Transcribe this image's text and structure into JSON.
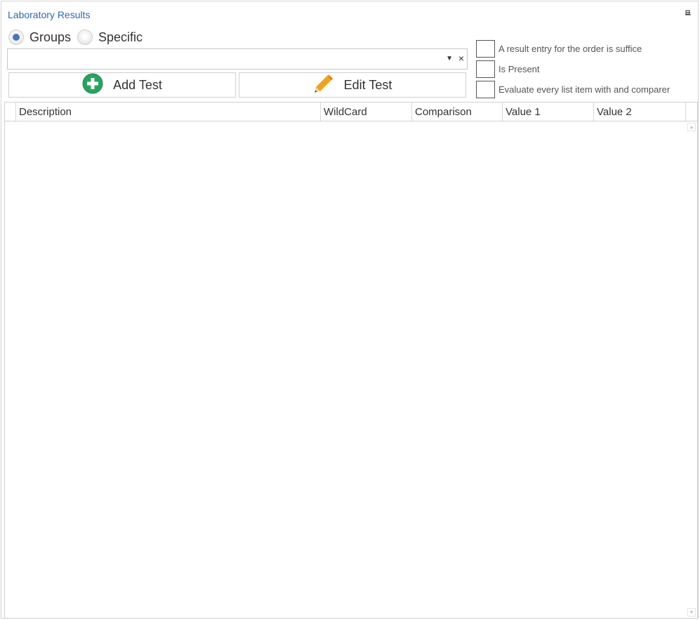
{
  "panel": {
    "title": "Laboratory Results",
    "pin_icon": "pin-icon"
  },
  "mode": {
    "options": [
      {
        "label": "Groups",
        "selected": true
      },
      {
        "label": "Specific",
        "selected": false
      }
    ]
  },
  "selector": {
    "value": "",
    "dropdown_icon": "chevron-down-icon",
    "clear_icon": "close-icon",
    "clear_glyph": "×",
    "arrow_glyph": "▼"
  },
  "buttons": {
    "add_label": "Add Test",
    "add_icon": "plus-circle-icon",
    "edit_label": "Edit Test",
    "edit_icon": "pencil-icon"
  },
  "options": [
    {
      "label": "A result entry for the order is suffice",
      "checked": false
    },
    {
      "label": "Is Present",
      "checked": false
    },
    {
      "label": "Evaluate every list item with and comparer",
      "checked": false
    }
  ],
  "grid": {
    "columns": [
      "Description",
      "WildCard",
      "Comparison",
      "Value 1",
      "Value 2"
    ],
    "rows": []
  },
  "colors": {
    "accent": "#2b6cb0",
    "radio_selected": "#4a74b8",
    "add_icon": "#27a35f",
    "edit_icon": "#f0a21f"
  }
}
